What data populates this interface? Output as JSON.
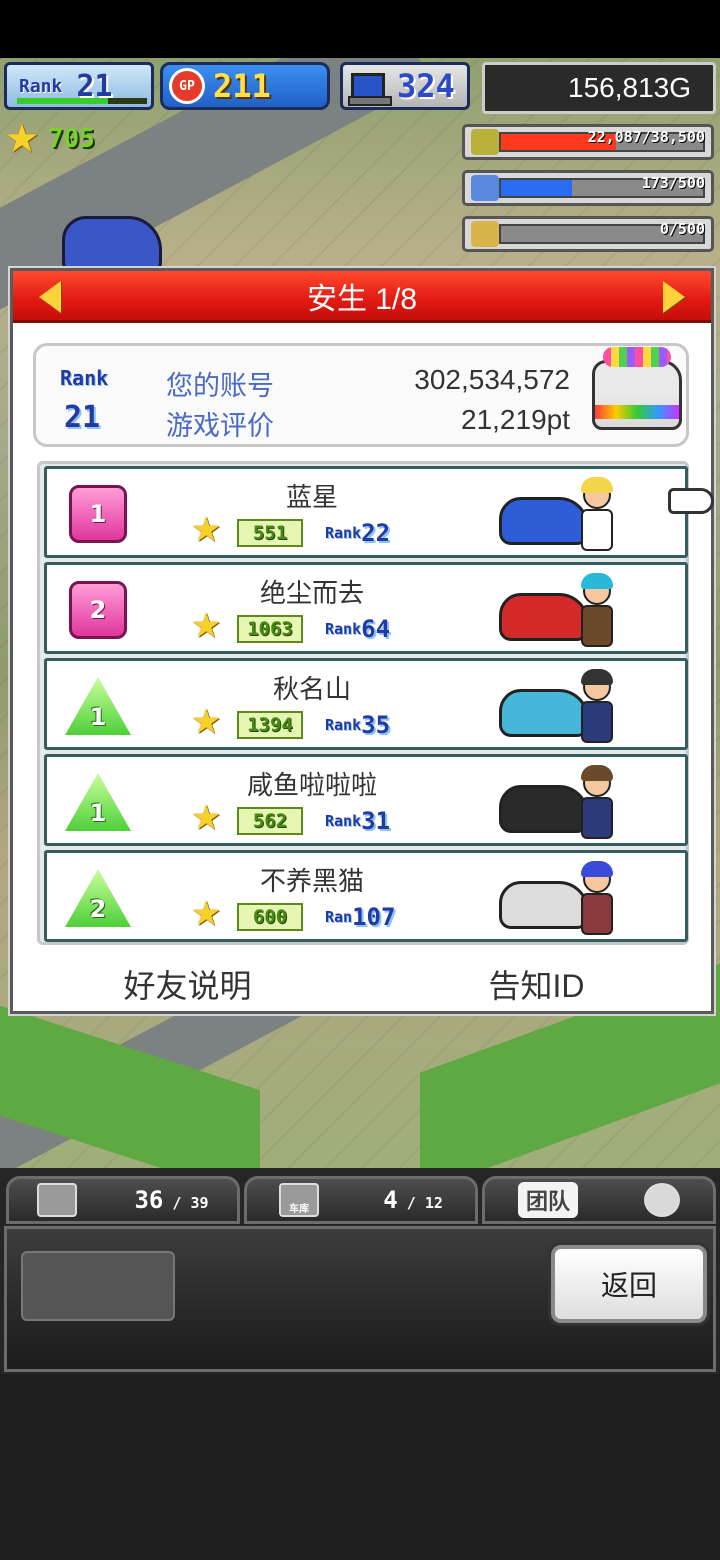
{
  "hud": {
    "rank_label": "Rank",
    "rank_value": "21",
    "gp_label": "GP",
    "gp_value": "211",
    "pc_value": "324",
    "money": "156,813G",
    "stars": "705"
  },
  "resources": [
    {
      "name": "coin",
      "text": "22,087/38,500",
      "fill_fraction": 0.57,
      "color": "#ff3a1c"
    },
    {
      "name": "fuel",
      "text": "173/500",
      "fill_fraction": 0.35,
      "color": "#2a6cf0"
    },
    {
      "name": "wheat",
      "text": "0/500",
      "fill_fraction": 0.0,
      "color": "#c8a23a"
    }
  ],
  "dialog": {
    "title": "安生 1/8",
    "account": {
      "rank_label": "Rank",
      "rank_value": "21",
      "account_label": "您的账号",
      "account_value": "302,534,572",
      "rating_label": "游戏评价",
      "rating_value": "21,219pt"
    },
    "friends": [
      {
        "badge": "1",
        "badge_style": "pink",
        "name": "蓝星",
        "stars": "551",
        "rank_label": "Rank",
        "rank": "22",
        "car_color": "#2d5ed8",
        "hair": "#f3d44a",
        "body": "#fff"
      },
      {
        "badge": "2",
        "badge_style": "pink",
        "name": "绝尘而去",
        "stars": "1063",
        "rank_label": "Rank",
        "rank": "64",
        "car_color": "#d52a2a",
        "hair": "#2ab8d8",
        "body": "#6a4a2a"
      },
      {
        "badge": "1",
        "badge_style": "green",
        "name": "秋名山",
        "stars": "1394",
        "rank_label": "Rank",
        "rank": "35",
        "car_color": "#47b7d9",
        "hair": "#333",
        "body": "#2a3a7a"
      },
      {
        "badge": "1",
        "badge_style": "green",
        "name": "咸鱼啦啦啦",
        "stars": "562",
        "rank_label": "Rank",
        "rank": "31",
        "car_color": "#2a2a2a",
        "hair": "#6a4a2a",
        "body": "#2a3a7a"
      },
      {
        "badge": "2",
        "badge_style": "green",
        "name": "不养黑猫",
        "stars": "600",
        "rank_label": "Ran",
        "rank": "107",
        "car_color": "#dcdcdc",
        "hair": "#3a4ad8",
        "body": "#8a3a3a"
      }
    ],
    "footer": {
      "left": "好友说明",
      "right": "告知ID"
    }
  },
  "bottom_bar": {
    "tab1": {
      "value": "36",
      "max": "39"
    },
    "tab2": {
      "icon_label": "车库",
      "value": "4",
      "max": "12"
    },
    "tab3": {
      "label": "团队"
    },
    "back_button": "返回"
  }
}
